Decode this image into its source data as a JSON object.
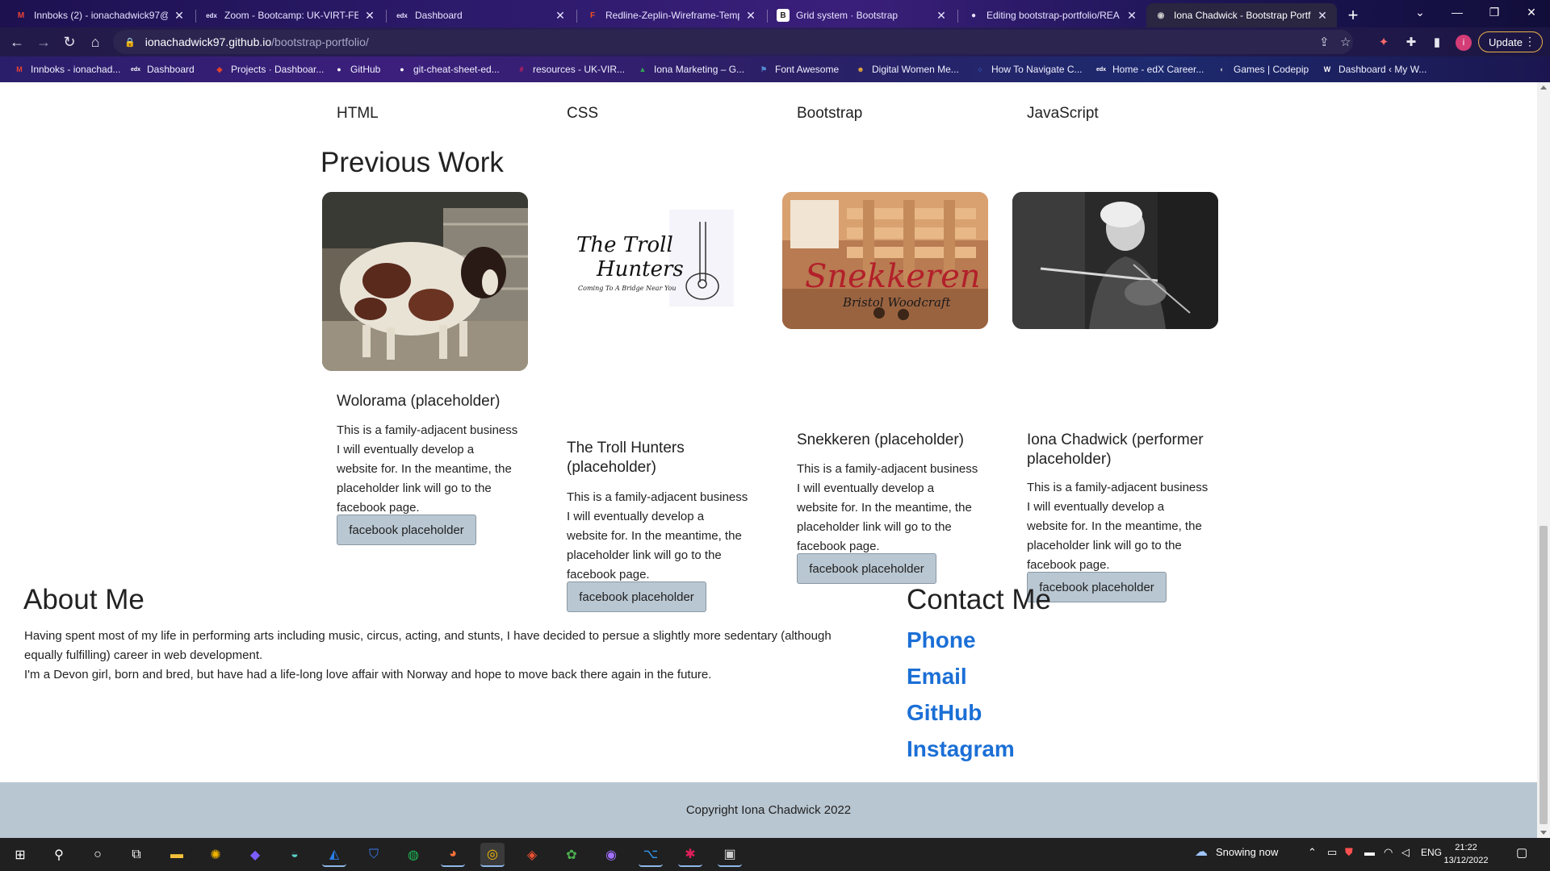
{
  "browser": {
    "tabs": [
      {
        "label": "Innboks (2) - ionachadwick97@",
        "icon": "gmail-icon",
        "icon_glyph": "M",
        "icon_color": "#ea4335"
      },
      {
        "label": "Zoom - Bootcamp: UK-VIRT-FE",
        "icon": "edx-icon",
        "icon_glyph": "edx",
        "icon_color": "#ffffff"
      },
      {
        "label": "Dashboard",
        "icon": "edx-icon",
        "icon_glyph": "edx",
        "icon_color": "#ffffff"
      },
      {
        "label": "Redline-Zeplin-Wireframe-Temp",
        "icon": "figma-icon",
        "icon_glyph": "F",
        "icon_color": "#f24e1e"
      },
      {
        "label": "Grid system · Bootstrap",
        "icon": "bootstrap-icon",
        "icon_glyph": "B",
        "icon_color": "#ffffff"
      },
      {
        "label": "Editing bootstrap-portfolio/REA",
        "icon": "github-icon",
        "icon_glyph": "●",
        "icon_color": "#ffffff"
      },
      {
        "label": "Iona Chadwick - Bootstrap Portf",
        "icon": "globe-icon",
        "icon_glyph": "◉",
        "icon_color": "#cccccc"
      }
    ],
    "close_glyph": "✕",
    "new_tab_glyph": "+",
    "window_controls": {
      "dropdown": "⌄",
      "minimize": "—",
      "restore": "❐",
      "close": "✕"
    },
    "nav": {
      "back": "←",
      "forward": "→",
      "reload": "↻",
      "home": "⌂"
    },
    "address": {
      "host": "ionachadwick97.github.io",
      "path": "/bootstrap-portfolio/",
      "lock": "🔒"
    },
    "toolbar_icons": {
      "share": "⇪",
      "star": "☆",
      "extension": "✦",
      "puzzle": "✚",
      "sidepanel": "▮",
      "menu": "⋮"
    },
    "profile_initial": "i",
    "update_label": "Update",
    "bookmarks": [
      {
        "label": "Innboks - ionachad...",
        "glyph": "M",
        "color": "#ea4335"
      },
      {
        "label": "Dashboard",
        "glyph": "edx",
        "color": "#2a2a2a"
      },
      {
        "label": "Projects · Dashboar...",
        "glyph": "◆",
        "color": "#e24329"
      },
      {
        "label": "GitHub",
        "glyph": "●",
        "color": "#222222"
      },
      {
        "label": "git-cheat-sheet-ed...",
        "glyph": "●",
        "color": "#222222"
      },
      {
        "label": "resources - UK-VIR...",
        "glyph": "#",
        "color": "#4a154b"
      },
      {
        "label": "Iona Marketing – G...",
        "glyph": "▲",
        "color": "#34a853"
      },
      {
        "label": "Font Awesome",
        "glyph": "⚑",
        "color": "#538dd7"
      },
      {
        "label": "Digital Women Me...",
        "glyph": "☻",
        "color": "#e7a93c"
      },
      {
        "label": "How To Navigate C...",
        "glyph": "○",
        "color": "#3d7cf2"
      },
      {
        "label": "Home - edX Career...",
        "glyph": "edx",
        "color": "#2a2a2a"
      },
      {
        "label": "Games | Codepip",
        "glyph": "◐",
        "color": "#555555"
      },
      {
        "label": "Dashboard ‹ My W...",
        "glyph": "W",
        "color": "#21759b"
      }
    ]
  },
  "page": {
    "skills": [
      "HTML",
      "CSS",
      "Bootstrap",
      "JavaScript"
    ],
    "previous_work_title": "Previous Work",
    "cards": [
      {
        "title": "Wolorama (placeholder)",
        "description": "This is a family-adjacent business I will eventually develop a website for. In the meantime, the placeholder link will go to the facebook page.",
        "button": "facebook placeholder",
        "image": "sheep-photo"
      },
      {
        "title": "The Troll Hunters (placeholder)",
        "description": "This is a family-adjacent business I will eventually develop a website for. In the meantime, the placeholder link will go to the facebook page.",
        "button": "facebook placeholder",
        "image": "troll-hunters-logo",
        "logo_line1": "The Troll",
        "logo_line2": "Hunters",
        "logo_tagline": "Coming To A Bridge Near You"
      },
      {
        "title": "Snekkeren (placeholder)",
        "description": "This is a family-adjacent business I will eventually develop a website for. In the meantime, the placeholder link will go to the facebook page.",
        "button": "facebook placeholder",
        "image": "snekkeren-logo",
        "logo_line1": "Snekkeren",
        "logo_line2": "Bristol Woodcraft"
      },
      {
        "title": "Iona Chadwick (performer placeholder)",
        "description": "This is a family-adjacent business I will eventually develop a website for. In the meantime, the placeholder link will go to the facebook page.",
        "button": "facebook placeholder",
        "image": "violinist-photo"
      }
    ],
    "about": {
      "title": "About Me",
      "paragraph1": "Having spent most of my life in performing arts including music, circus, acting, and stunts, I have decided to persue a slightly more sedentary (although equally fulfilling) career in web development.",
      "paragraph2": "I'm a Devon girl, born and bred, but have had a life-long love affair with Norway and hope to move back there again in the future."
    },
    "contact": {
      "title": "Contact Me",
      "links": [
        "Phone",
        "Email",
        "GitHub",
        "Instagram"
      ]
    },
    "footer": "Copyright Iona Chadwick 2022"
  },
  "taskbar": {
    "weather": "Snowing now",
    "language": "ENG",
    "time": "21:22",
    "date": "13/12/2022",
    "apps": [
      {
        "name": "start-icon",
        "glyph": "⊞",
        "color": "#ffffff"
      },
      {
        "name": "search-icon",
        "glyph": "⚲",
        "color": "#ffffff"
      },
      {
        "name": "cortana-icon",
        "glyph": "○",
        "color": "#ffffff"
      },
      {
        "name": "task-view-icon",
        "glyph": "⧉",
        "color": "#ffffff"
      },
      {
        "name": "file-explorer-icon",
        "glyph": "▬",
        "color": "#f3c13a"
      },
      {
        "name": "app-icon",
        "glyph": "✺",
        "color": "#f0b400"
      },
      {
        "name": "app-icon",
        "glyph": "◆",
        "color": "#7b5cff"
      },
      {
        "name": "app-icon",
        "glyph": "◒",
        "color": "#5ad0c8"
      },
      {
        "name": "app-icon",
        "glyph": "◭",
        "color": "#2b7de9"
      },
      {
        "name": "vpn-icon",
        "glyph": "⛉",
        "color": "#3c7df0"
      },
      {
        "name": "spotify-icon",
        "glyph": "◍",
        "color": "#1db954"
      },
      {
        "name": "firefox-icon",
        "glyph": "◕",
        "color": "#ff7139"
      },
      {
        "name": "chrome-icon",
        "glyph": "◎",
        "color": "#fbbc04"
      },
      {
        "name": "git-icon",
        "glyph": "◈",
        "color": "#f05033"
      },
      {
        "name": "app-icon",
        "glyph": "✿",
        "color": "#4caf50"
      },
      {
        "name": "github-desktop-icon",
        "glyph": "◉",
        "color": "#a070ff"
      },
      {
        "name": "vscode-icon",
        "glyph": "⌥",
        "color": "#2f9af2"
      },
      {
        "name": "slack-icon",
        "glyph": "✱",
        "color": "#e01e5a"
      },
      {
        "name": "terminal-icon",
        "glyph": "▣",
        "color": "#cccccc"
      }
    ]
  }
}
